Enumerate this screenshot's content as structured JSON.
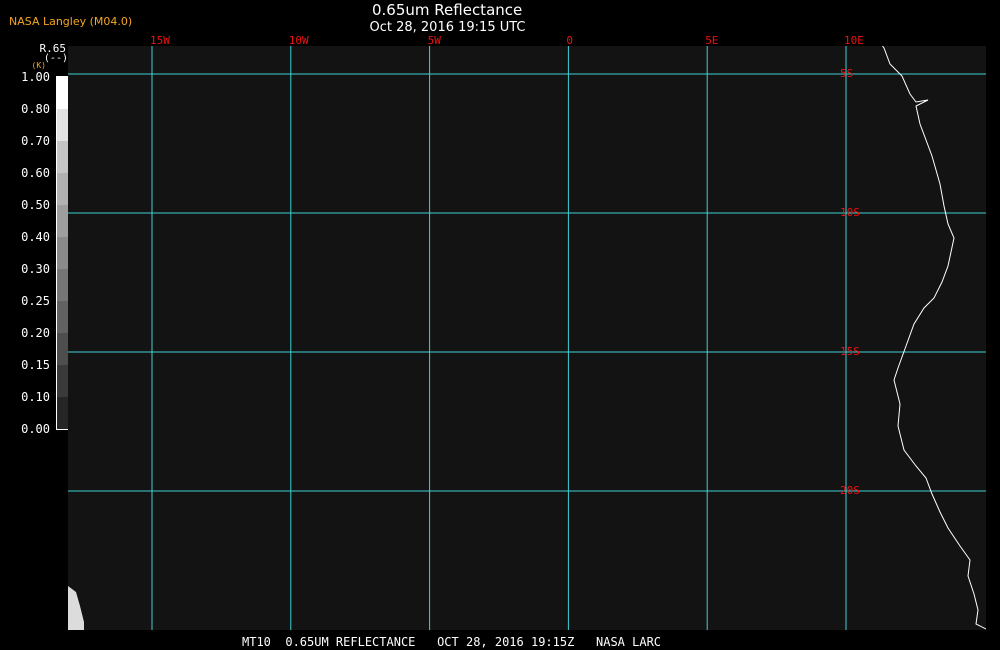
{
  "header": {
    "credit": "NASA Langley (M04.0)",
    "title": "0.65um Reflectance",
    "subtitle": "Oct 28, 2016 19:15 UTC"
  },
  "colorbar": {
    "var_label": "R.65",
    "unit_label": "(--)",
    "unit_small": "(K)",
    "ticks": [
      "1.00",
      "0.80",
      "0.70",
      "0.60",
      "0.50",
      "0.40",
      "0.30",
      "0.25",
      "0.20",
      "0.15",
      "0.10",
      "0.00"
    ],
    "swatches": [
      "#ffffff",
      "#e3e3e3",
      "#c6c6c6",
      "#b2b2b2",
      "#9e9e9e",
      "#8a8a8a",
      "#767676",
      "#626262",
      "#4e4e4e",
      "#3a3a3a",
      "#262626"
    ]
  },
  "map": {
    "background": "#131313",
    "grid_color": "#3fd0d4",
    "coast_color": "#ffffff",
    "lon_lines": [
      {
        "label": "15W",
        "value": -15
      },
      {
        "label": "10W",
        "value": -10
      },
      {
        "label": "5W",
        "value": -5
      },
      {
        "label": "0",
        "value": 0
      },
      {
        "label": "5E",
        "value": 5
      },
      {
        "label": "10E",
        "value": 10
      }
    ],
    "lat_lines": [
      {
        "label": "5S",
        "value": -5
      },
      {
        "label": "10S",
        "value": -10
      },
      {
        "label": "15S",
        "value": -15
      },
      {
        "label": "20S",
        "value": -20
      }
    ]
  },
  "footer": {
    "text": "MT10  0.65UM REFLECTANCE   OCT 28, 2016 19:15Z   NASA LARC"
  }
}
